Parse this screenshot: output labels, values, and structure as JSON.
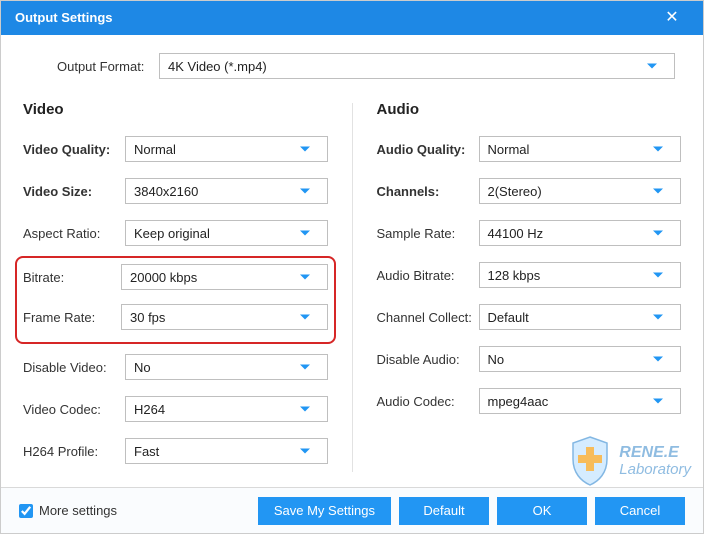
{
  "title": "Output Settings",
  "outputFormat": {
    "label": "Output Format:",
    "value": "4K Video (*.mp4)"
  },
  "video": {
    "heading": "Video",
    "rows": {
      "quality": {
        "label": "Video Quality:",
        "value": "Normal",
        "bold": true
      },
      "size": {
        "label": "Video Size:",
        "value": "3840x2160",
        "bold": true
      },
      "aspect": {
        "label": "Aspect Ratio:",
        "value": "Keep original",
        "bold": false
      },
      "bitrate": {
        "label": "Bitrate:",
        "value": "20000 kbps",
        "bold": false
      },
      "framerate": {
        "label": "Frame Rate:",
        "value": "30 fps",
        "bold": false
      },
      "disable": {
        "label": "Disable Video:",
        "value": "No",
        "bold": false
      },
      "codec": {
        "label": "Video Codec:",
        "value": "H264",
        "bold": false
      },
      "profile": {
        "label": "H264 Profile:",
        "value": "Fast",
        "bold": false
      }
    }
  },
  "audio": {
    "heading": "Audio",
    "rows": {
      "quality": {
        "label": "Audio Quality:",
        "value": "Normal",
        "bold": true
      },
      "channels": {
        "label": "Channels:",
        "value": "2(Stereo)",
        "bold": true
      },
      "sample": {
        "label": "Sample Rate:",
        "value": "44100 Hz",
        "bold": false
      },
      "bitrate": {
        "label": "Audio Bitrate:",
        "value": "128 kbps",
        "bold": false
      },
      "collect": {
        "label": "Channel Collect:",
        "value": "Default",
        "bold": false
      },
      "disable": {
        "label": "Disable Audio:",
        "value": "No",
        "bold": false
      },
      "codec": {
        "label": "Audio Codec:",
        "value": "mpeg4aac",
        "bold": false
      }
    }
  },
  "footer": {
    "more": "More settings",
    "save": "Save My Settings",
    "default": "Default",
    "ok": "OK",
    "cancel": "Cancel"
  },
  "watermark": {
    "line1": "RENE.E",
    "line2": "Laboratory"
  }
}
